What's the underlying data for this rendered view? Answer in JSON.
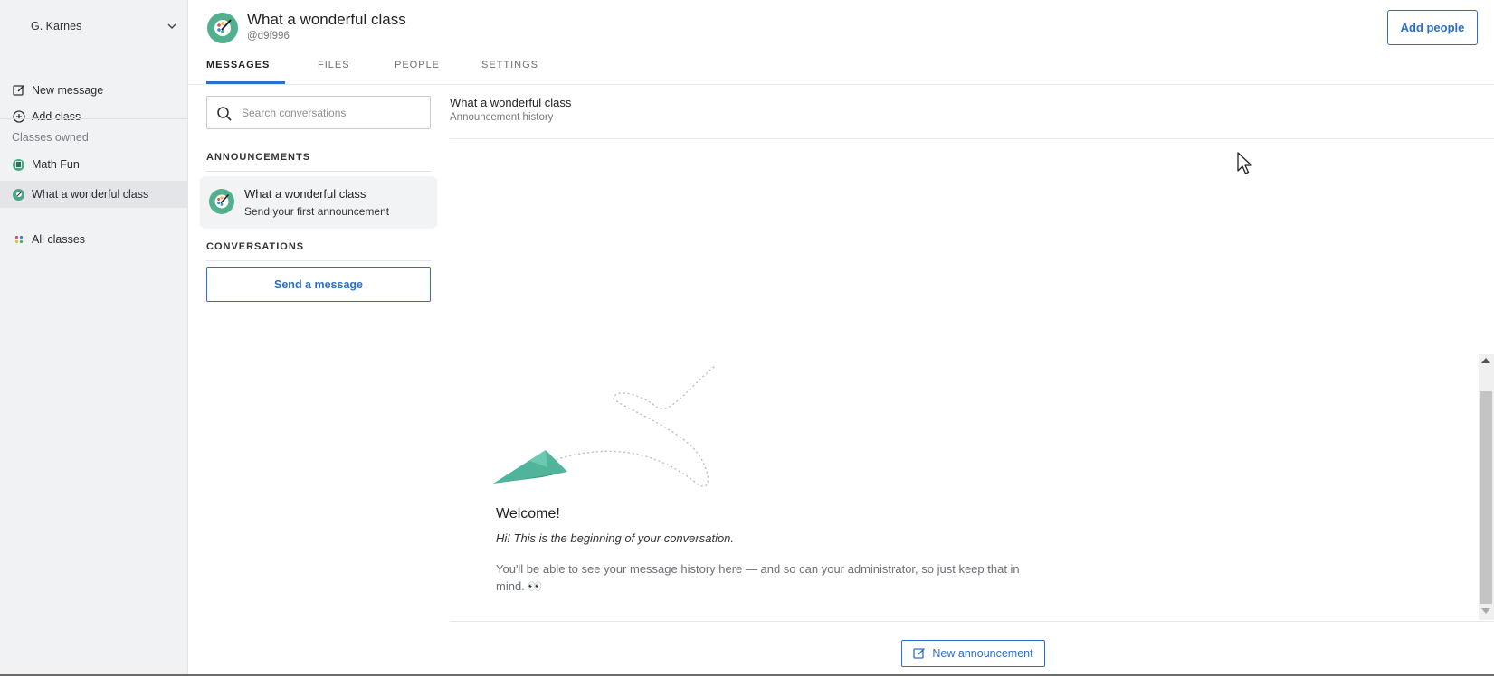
{
  "sidebar": {
    "user_name": "G. Karnes",
    "new_message": "New message",
    "add_class": "Add class",
    "classes_owned_label": "Classes owned",
    "classes": [
      {
        "name": "Math Fun",
        "active": false
      },
      {
        "name": "What a wonderful class",
        "active": true
      }
    ],
    "all_classes": "All classes"
  },
  "header": {
    "class_title": "What a wonderful class",
    "class_code": "@d9f996",
    "add_people": "Add people",
    "tabs": [
      {
        "label": "MESSAGES",
        "active": true
      },
      {
        "label": "FILES",
        "active": false
      },
      {
        "label": "PEOPLE",
        "active": false
      },
      {
        "label": "SETTINGS",
        "active": false
      }
    ]
  },
  "list": {
    "search_placeholder": "Search conversations",
    "announcements_heading": "ANNOUNCEMENTS",
    "announcement": {
      "title": "What a wonderful class",
      "subtitle": "Send your first announcement"
    },
    "conversations_heading": "CONVERSATIONS",
    "send_message": "Send a message"
  },
  "conversation": {
    "title": "What a wonderful class",
    "subtitle": "Announcement history",
    "welcome": "Welcome!",
    "intro": "Hi! This is the beginning of your conversation.",
    "history_note": "You'll be able to see your message history here — and so can your administrator, so just keep that in mind. 👀",
    "new_announcement": "New announcement"
  },
  "colors": {
    "accent": "#2a6fc9",
    "class_green": "#52b08e",
    "sidebar_bg": "#f1f2f3"
  }
}
